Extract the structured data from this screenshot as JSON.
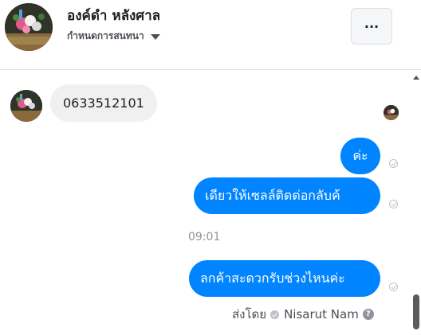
{
  "header": {
    "contact_name": "องค์ดำ หลังศาล",
    "subtitle": "กำหนดการสนทนา",
    "more_label": "...",
    "avatar_icon": "contact-photo",
    "caret_icon": "caret-down-icon"
  },
  "messages": [
    {
      "direction": "incoming",
      "text": "0633512101"
    },
    {
      "direction": "outgoing",
      "text": "ค่ะ"
    },
    {
      "direction": "outgoing",
      "text": "เดียวให้เซลล์ติดต่อกลับค้"
    },
    {
      "direction": "outgoing",
      "text": "ลกค้าสะดวกรับช่วงไหนค่ะ"
    }
  ],
  "timestamp": "09:01",
  "sent_by": {
    "prefix": "ส่งโดย",
    "name": "Nisarut Nam",
    "help": "?"
  },
  "colors": {
    "outgoing_bubble": "#0084ff",
    "incoming_bubble": "#f1f0f0",
    "meta_text": "#90949c"
  }
}
